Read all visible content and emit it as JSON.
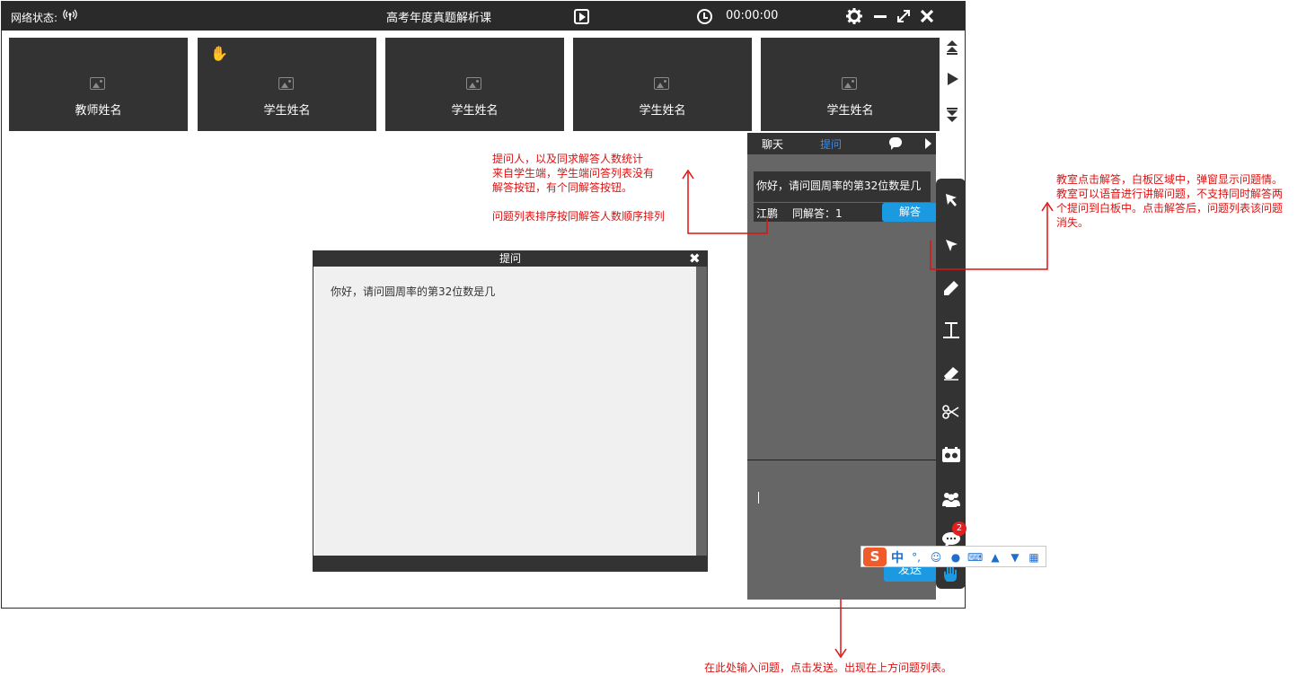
{
  "titlebar": {
    "network_label": "网络状态:",
    "title": "高考年度真题解析课",
    "timer": "00:00:00"
  },
  "videos": [
    {
      "name": "教师姓名",
      "hand_raised": false
    },
    {
      "name": "学生姓名",
      "hand_raised": true
    },
    {
      "name": "学生姓名",
      "hand_raised": false
    },
    {
      "name": "学生姓名",
      "hand_raised": false
    },
    {
      "name": "学生姓名",
      "hand_raised": false
    }
  ],
  "panel": {
    "tabs": [
      {
        "label": "聊天",
        "active": false
      },
      {
        "label": "提问",
        "active": true
      }
    ],
    "question": {
      "text": "你好，请问圆周率的第32位数是几",
      "asker": "江鹏",
      "count_label": "同解答：1",
      "answer_button": "解答"
    },
    "send_button": "发送"
  },
  "toolbar": {
    "chat_badge": "2"
  },
  "dialog": {
    "title": "提问",
    "body": "你好，请问圆周率的第32位数是几"
  },
  "ime": {
    "logo": "S",
    "mode": "中",
    "punct": "°,"
  },
  "annotations": {
    "left_note": [
      "提问人，以及同求解答人数统计",
      "来自学生端，学生端问答列表没有",
      "解答按钮，有个同解答按钮。",
      "",
      "问题列表排序按同解答人数顺序排列"
    ],
    "right_note": [
      "教室点击解答，白板区域中，弹窗显示问题情。",
      "教室可以语音进行讲解问题，不支持同时解答两",
      "个提问到白板中。点击解答后，问题列表该问题",
      "消失。"
    ],
    "bottom_note": "在此处输入问题，点击发送。出现在上方问题列表。"
  },
  "colors": {
    "titlebar": "#2a2a2a",
    "tile": "#333333",
    "panel": "#666666",
    "accent_blue": "#1b9ae2",
    "tab_active": "#3d8ee8",
    "annotation": "#e01010",
    "hand": "#ffd400"
  }
}
